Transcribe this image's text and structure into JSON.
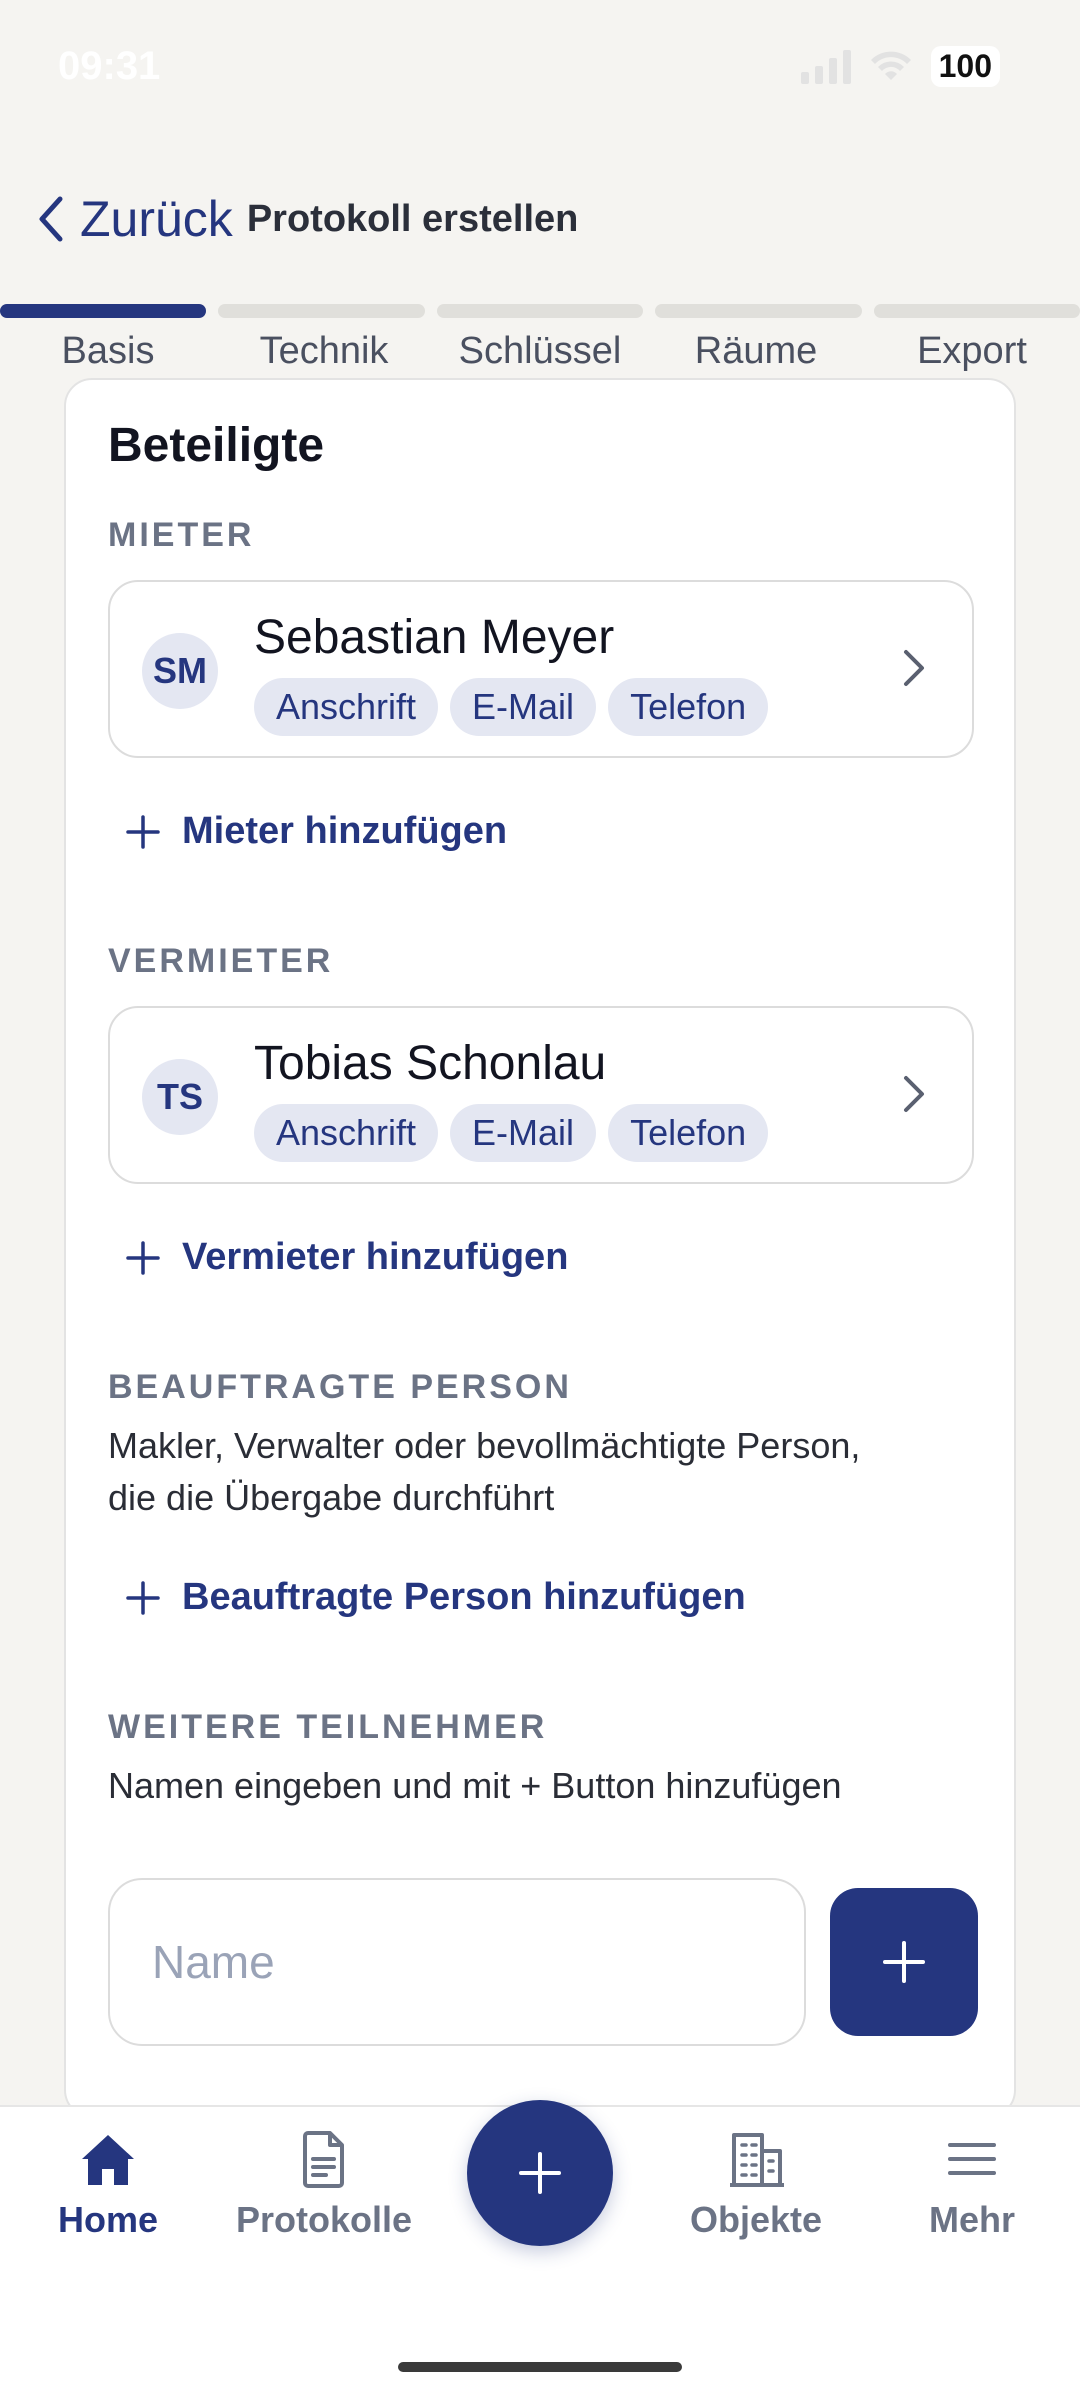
{
  "status": {
    "time": "09:31",
    "battery": "100"
  },
  "header": {
    "back_label": "Zurück",
    "title": "Protokoll erstellen"
  },
  "steps": [
    "Basis",
    "Technik",
    "Schlüssel",
    "Räume",
    "Export"
  ],
  "active_step": 0,
  "card": {
    "title": "Beteiligte",
    "tenants": {
      "label": "MIETER",
      "person": {
        "initials": "SM",
        "name": "Sebastian Meyer",
        "chips": [
          "Anschrift",
          "E-Mail",
          "Telefon"
        ]
      },
      "add_label": "Mieter hinzufügen"
    },
    "landlords": {
      "label": "VERMIETER",
      "person": {
        "initials": "TS",
        "name": "Tobias Schonlau",
        "chips": [
          "Anschrift",
          "E-Mail",
          "Telefon"
        ]
      },
      "add_label": "Vermieter hinzufügen"
    },
    "agent": {
      "label": "BEAUFTRAGTE PERSON",
      "desc_line1": "Makler, Verwalter oder bevollmächtigte Person,",
      "desc_line2": "die die Übergabe durchführt",
      "add_label": "Beauftragte Person hinzufügen"
    },
    "others": {
      "label": "WEITERE TEILNEHMER",
      "desc": "Namen eingeben und mit + Button hinzufügen",
      "input_placeholder": "Name",
      "input_value": ""
    }
  },
  "nav": {
    "home": "Home",
    "protocols": "Protokolle",
    "objects": "Objekte",
    "more": "Mehr"
  },
  "colors": {
    "accent": "#25367f",
    "chip_bg": "#e4e7f2",
    "muted": "#6b7385"
  }
}
